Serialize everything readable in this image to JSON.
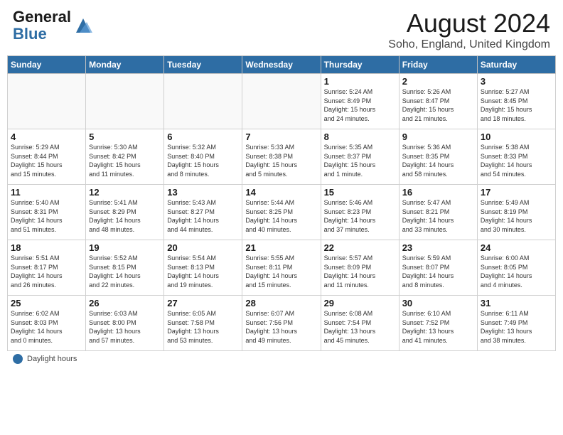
{
  "header": {
    "logo_general": "General",
    "logo_blue": "Blue",
    "main_title": "August 2024",
    "subtitle": "Soho, England, United Kingdom"
  },
  "calendar": {
    "headers": [
      "Sunday",
      "Monday",
      "Tuesday",
      "Wednesday",
      "Thursday",
      "Friday",
      "Saturday"
    ],
    "weeks": [
      [
        {
          "day": "",
          "info": ""
        },
        {
          "day": "",
          "info": ""
        },
        {
          "day": "",
          "info": ""
        },
        {
          "day": "",
          "info": ""
        },
        {
          "day": "1",
          "info": "Sunrise: 5:24 AM\nSunset: 8:49 PM\nDaylight: 15 hours\nand 24 minutes."
        },
        {
          "day": "2",
          "info": "Sunrise: 5:26 AM\nSunset: 8:47 PM\nDaylight: 15 hours\nand 21 minutes."
        },
        {
          "day": "3",
          "info": "Sunrise: 5:27 AM\nSunset: 8:45 PM\nDaylight: 15 hours\nand 18 minutes."
        }
      ],
      [
        {
          "day": "4",
          "info": "Sunrise: 5:29 AM\nSunset: 8:44 PM\nDaylight: 15 hours\nand 15 minutes."
        },
        {
          "day": "5",
          "info": "Sunrise: 5:30 AM\nSunset: 8:42 PM\nDaylight: 15 hours\nand 11 minutes."
        },
        {
          "day": "6",
          "info": "Sunrise: 5:32 AM\nSunset: 8:40 PM\nDaylight: 15 hours\nand 8 minutes."
        },
        {
          "day": "7",
          "info": "Sunrise: 5:33 AM\nSunset: 8:38 PM\nDaylight: 15 hours\nand 5 minutes."
        },
        {
          "day": "8",
          "info": "Sunrise: 5:35 AM\nSunset: 8:37 PM\nDaylight: 15 hours\nand 1 minute."
        },
        {
          "day": "9",
          "info": "Sunrise: 5:36 AM\nSunset: 8:35 PM\nDaylight: 14 hours\nand 58 minutes."
        },
        {
          "day": "10",
          "info": "Sunrise: 5:38 AM\nSunset: 8:33 PM\nDaylight: 14 hours\nand 54 minutes."
        }
      ],
      [
        {
          "day": "11",
          "info": "Sunrise: 5:40 AM\nSunset: 8:31 PM\nDaylight: 14 hours\nand 51 minutes."
        },
        {
          "day": "12",
          "info": "Sunrise: 5:41 AM\nSunset: 8:29 PM\nDaylight: 14 hours\nand 48 minutes."
        },
        {
          "day": "13",
          "info": "Sunrise: 5:43 AM\nSunset: 8:27 PM\nDaylight: 14 hours\nand 44 minutes."
        },
        {
          "day": "14",
          "info": "Sunrise: 5:44 AM\nSunset: 8:25 PM\nDaylight: 14 hours\nand 40 minutes."
        },
        {
          "day": "15",
          "info": "Sunrise: 5:46 AM\nSunset: 8:23 PM\nDaylight: 14 hours\nand 37 minutes."
        },
        {
          "day": "16",
          "info": "Sunrise: 5:47 AM\nSunset: 8:21 PM\nDaylight: 14 hours\nand 33 minutes."
        },
        {
          "day": "17",
          "info": "Sunrise: 5:49 AM\nSunset: 8:19 PM\nDaylight: 14 hours\nand 30 minutes."
        }
      ],
      [
        {
          "day": "18",
          "info": "Sunrise: 5:51 AM\nSunset: 8:17 PM\nDaylight: 14 hours\nand 26 minutes."
        },
        {
          "day": "19",
          "info": "Sunrise: 5:52 AM\nSunset: 8:15 PM\nDaylight: 14 hours\nand 22 minutes."
        },
        {
          "day": "20",
          "info": "Sunrise: 5:54 AM\nSunset: 8:13 PM\nDaylight: 14 hours\nand 19 minutes."
        },
        {
          "day": "21",
          "info": "Sunrise: 5:55 AM\nSunset: 8:11 PM\nDaylight: 14 hours\nand 15 minutes."
        },
        {
          "day": "22",
          "info": "Sunrise: 5:57 AM\nSunset: 8:09 PM\nDaylight: 14 hours\nand 11 minutes."
        },
        {
          "day": "23",
          "info": "Sunrise: 5:59 AM\nSunset: 8:07 PM\nDaylight: 14 hours\nand 8 minutes."
        },
        {
          "day": "24",
          "info": "Sunrise: 6:00 AM\nSunset: 8:05 PM\nDaylight: 14 hours\nand 4 minutes."
        }
      ],
      [
        {
          "day": "25",
          "info": "Sunrise: 6:02 AM\nSunset: 8:03 PM\nDaylight: 14 hours\nand 0 minutes."
        },
        {
          "day": "26",
          "info": "Sunrise: 6:03 AM\nSunset: 8:00 PM\nDaylight: 13 hours\nand 57 minutes."
        },
        {
          "day": "27",
          "info": "Sunrise: 6:05 AM\nSunset: 7:58 PM\nDaylight: 13 hours\nand 53 minutes."
        },
        {
          "day": "28",
          "info": "Sunrise: 6:07 AM\nSunset: 7:56 PM\nDaylight: 13 hours\nand 49 minutes."
        },
        {
          "day": "29",
          "info": "Sunrise: 6:08 AM\nSunset: 7:54 PM\nDaylight: 13 hours\nand 45 minutes."
        },
        {
          "day": "30",
          "info": "Sunrise: 6:10 AM\nSunset: 7:52 PM\nDaylight: 13 hours\nand 41 minutes."
        },
        {
          "day": "31",
          "info": "Sunrise: 6:11 AM\nSunset: 7:49 PM\nDaylight: 13 hours\nand 38 minutes."
        }
      ]
    ]
  },
  "footer": {
    "label": "Daylight hours"
  }
}
